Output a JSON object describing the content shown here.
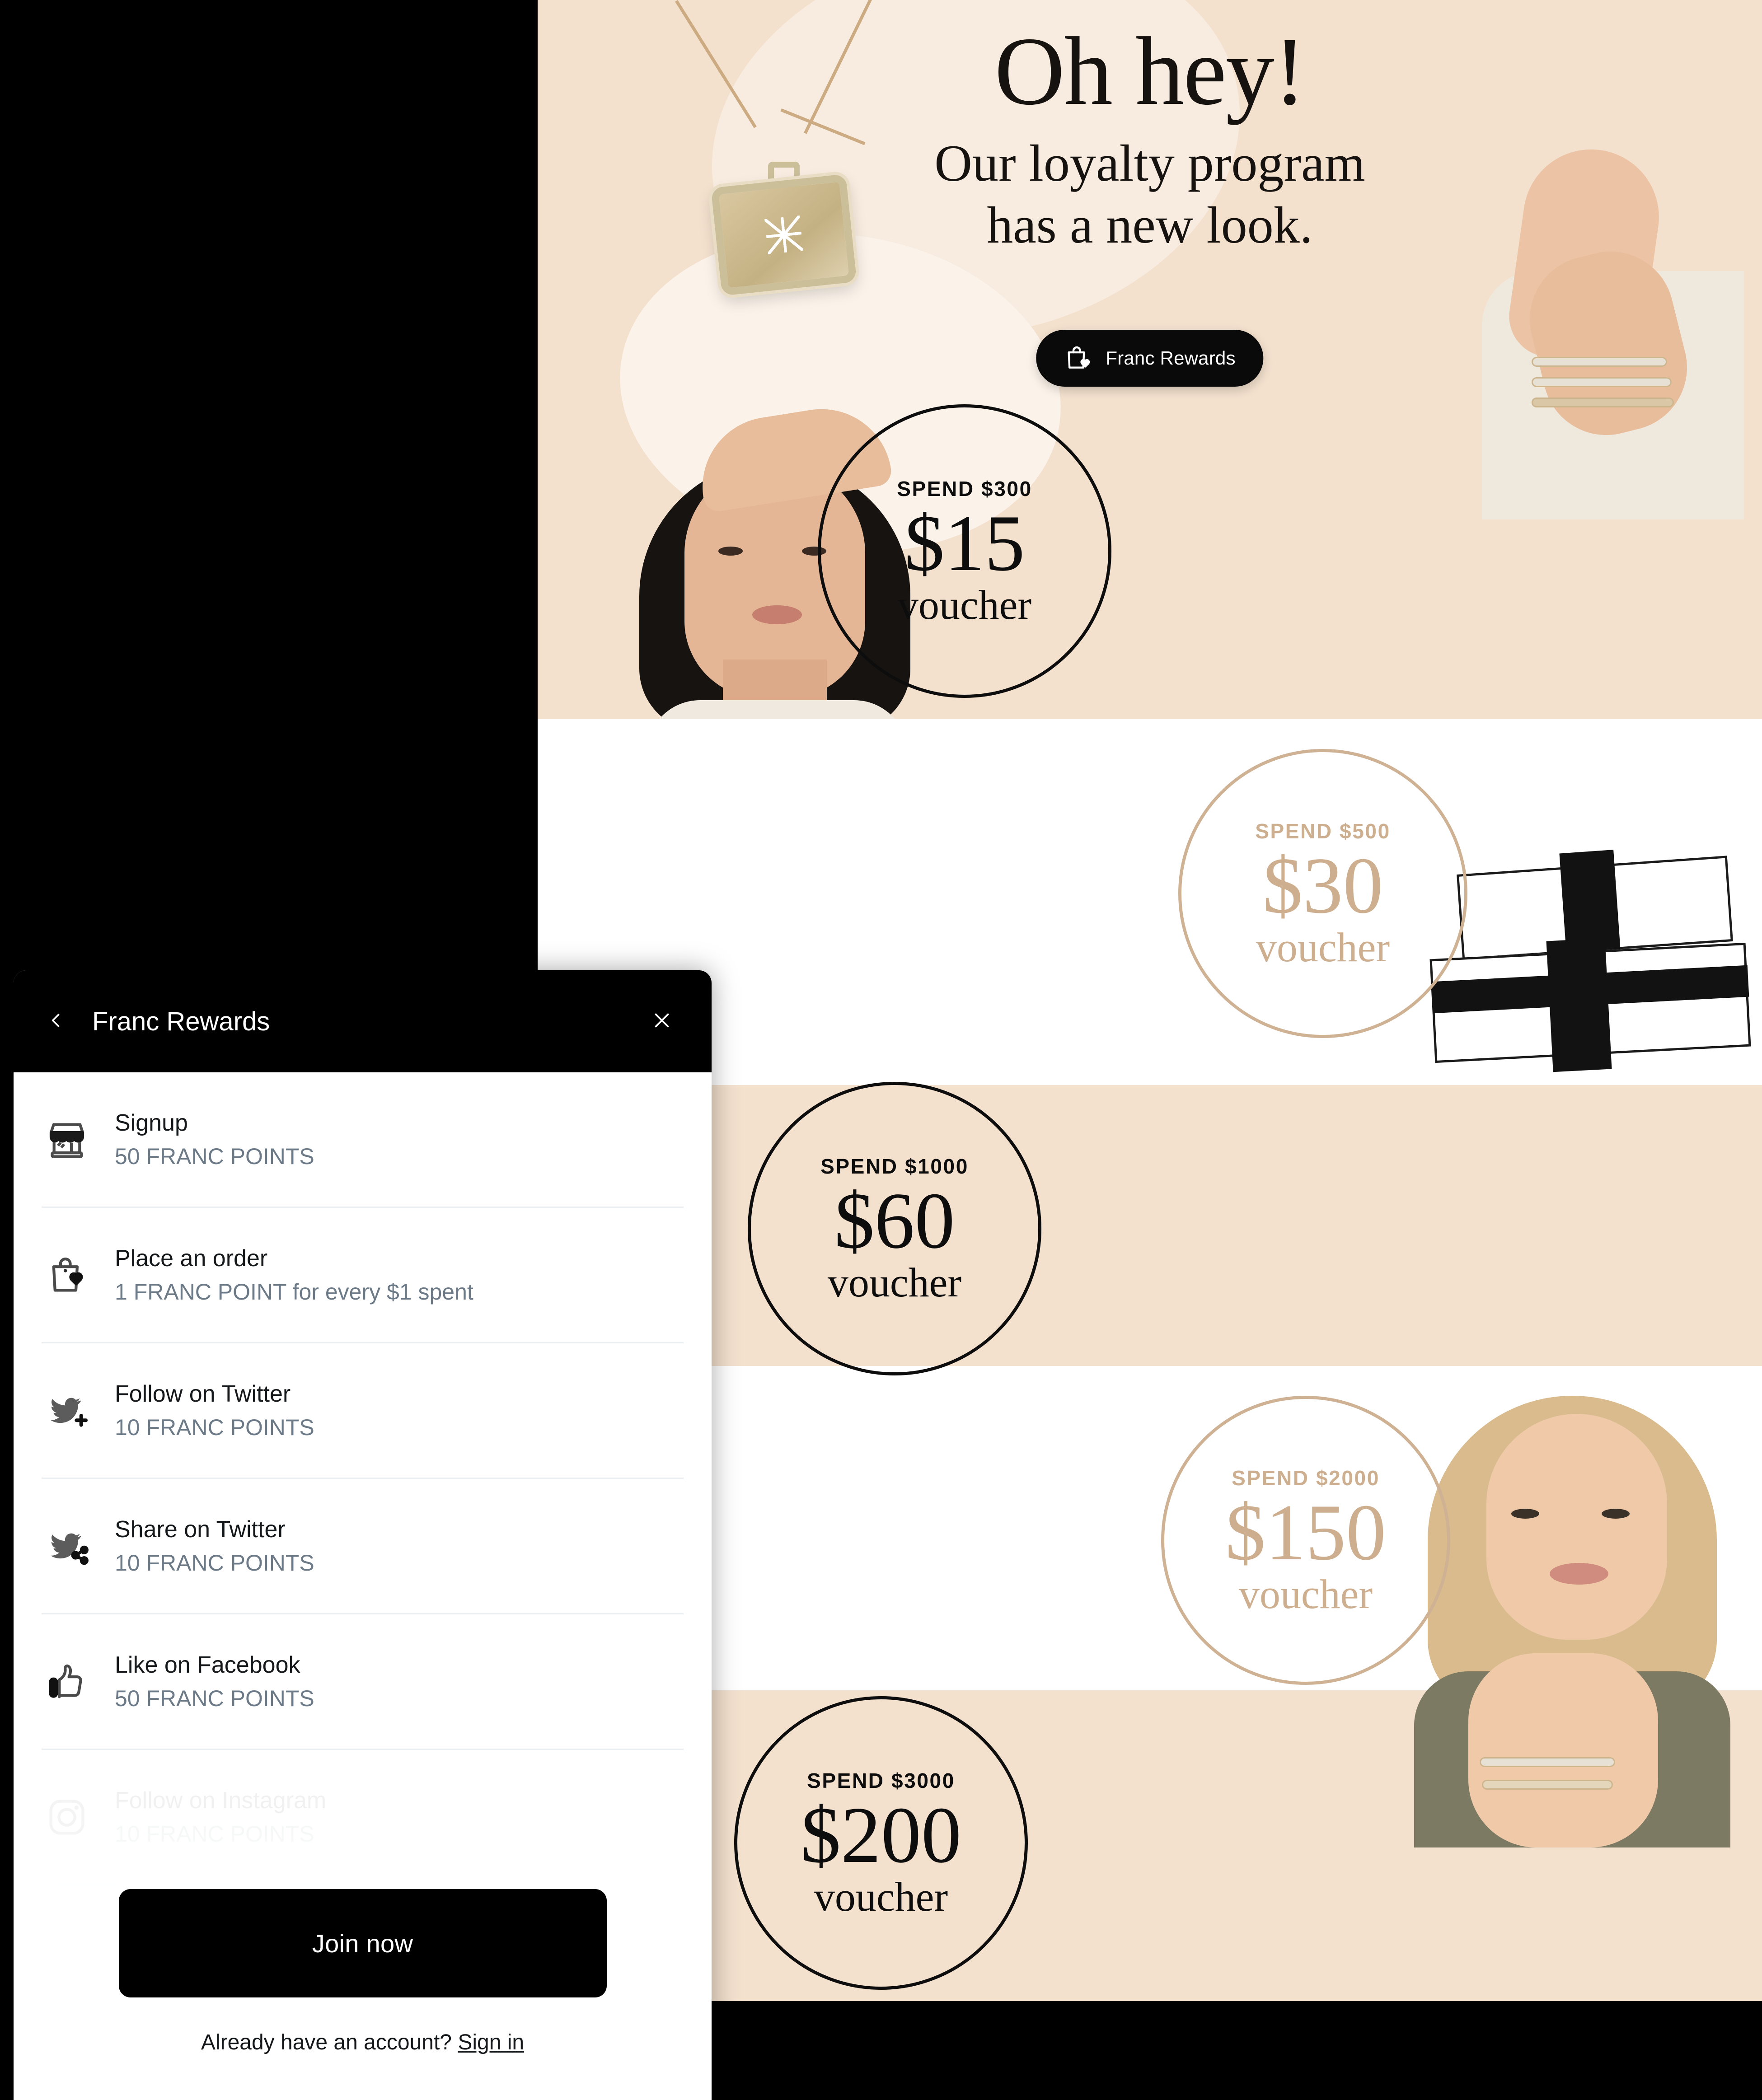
{
  "promo": {
    "headline_line1": "Oh hey!",
    "headline_line2": "Our loyalty program",
    "headline_line3": "has a new look.",
    "brand_pill_label": "Franc Rewards",
    "brand_pill_icon": "shopping-bag-heart-icon",
    "vouchers": [
      {
        "spend": "SPEND $300",
        "amount": "$15",
        "unit": "voucher",
        "style": "dark"
      },
      {
        "spend": "SPEND $500",
        "amount": "$30",
        "unit": "voucher",
        "style": "light"
      },
      {
        "spend": "SPEND $1000",
        "amount": "$60",
        "unit": "voucher",
        "style": "dark"
      },
      {
        "spend": "SPEND $2000",
        "amount": "$150",
        "unit": "voucher",
        "style": "light"
      },
      {
        "spend": "SPEND $3000",
        "amount": "$200",
        "unit": "voucher",
        "style": "dark"
      }
    ],
    "colors": {
      "tan_band": "#f3e0cd",
      "white_band": "#ffffff",
      "dark_badge": "#0d0d0d",
      "light_badge": "#cdaf8f"
    }
  },
  "panel": {
    "title": "Franc Rewards",
    "back_icon": "chevron-left-icon",
    "close_icon": "close-icon",
    "rewards": [
      {
        "icon": "storefront-icon",
        "title": "Signup",
        "sub": "50 FRANC POINTS"
      },
      {
        "icon": "shopping-bag-icon",
        "title": "Place an order",
        "sub": "1 FRANC POINT for every $1 spent"
      },
      {
        "icon": "twitter-follow-icon",
        "title": "Follow on Twitter",
        "sub": "10 FRANC POINTS"
      },
      {
        "icon": "twitter-share-icon",
        "title": "Share on Twitter",
        "sub": "10 FRANC POINTS"
      },
      {
        "icon": "thumbs-up-icon",
        "title": "Like on Facebook",
        "sub": "50 FRANC POINTS"
      },
      {
        "icon": "instagram-icon",
        "title": "Follow on Instagram",
        "sub": "10 FRANC POINTS"
      }
    ],
    "join_label": "Join now",
    "signin_prefix": "Already have an account? ",
    "signin_link": "Sign in",
    "colors": {
      "header_bg": "#000000",
      "title_text": "#15181a",
      "sub_text": "#6c7a87",
      "divider": "#eceff1"
    }
  }
}
